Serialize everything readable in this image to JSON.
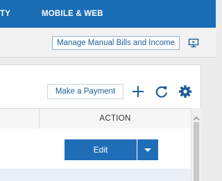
{
  "nav": {
    "items": [
      {
        "label": "TY"
      },
      {
        "label": "MOBILE & WEB"
      }
    ]
  },
  "toolbar": {
    "manage_label": "Manage Manual Bills and Income",
    "screen_icon": "screen-icon"
  },
  "panel": {
    "payment_label": "Make a Payment",
    "icons": [
      "plus-icon",
      "refresh-icon",
      "gear-icon"
    ]
  },
  "table": {
    "action_header": "ACTION",
    "row": {
      "edit_label": "Edit"
    }
  },
  "colors": {
    "nav_bg": "#1a6db5",
    "accent": "#1f6db7",
    "link_text": "#1c5d97",
    "selected_row": "#e9eef7"
  }
}
